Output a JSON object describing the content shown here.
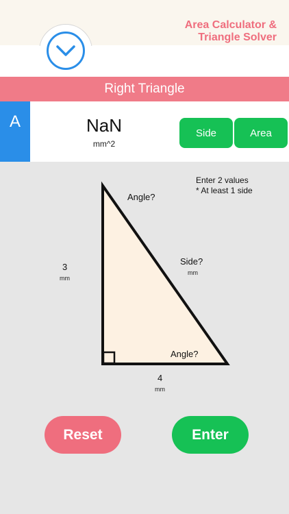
{
  "header": {
    "brand_line1": "Area Calculator &",
    "brand_line2": "Triangle Solver",
    "menu_icon": "chevron-down-icon"
  },
  "title": "Right Triangle",
  "result": {
    "letter": "A",
    "value": "NaN",
    "unit": "mm^2"
  },
  "modes": {
    "side": "Side",
    "area": "Area"
  },
  "hint": {
    "line1": "Enter 2 values",
    "line2": "* At least 1 side"
  },
  "triangle": {
    "fill": "#fdf1e2",
    "top_angle": "Angle?",
    "hypotenuse": "Side?",
    "hypotenuse_unit": "mm",
    "left_side": "3",
    "left_unit": "mm",
    "bottom_angle": "Angle?",
    "bottom_side": "4",
    "bottom_unit": "mm"
  },
  "buttons": {
    "reset": "Reset",
    "enter": "Enter"
  },
  "colors": {
    "accent_pink": "#ef6e7e",
    "accent_blue": "#2a8ee8",
    "accent_green": "#16c155"
  }
}
